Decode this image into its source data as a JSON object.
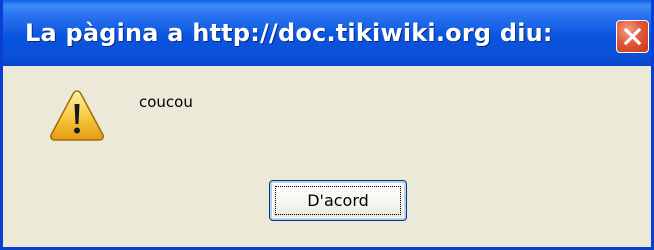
{
  "dialog": {
    "title": "La pàgina a http://doc.tikiwiki.org diu:",
    "message": "coucou",
    "ok_label": "D'acord"
  },
  "icons": {
    "warning": "warning-icon",
    "close": "close-icon"
  },
  "colors": {
    "titlebar": "#0a55de",
    "body": "#ece9d8",
    "close_button": "#e2583a",
    "warning": "#f5c542"
  }
}
